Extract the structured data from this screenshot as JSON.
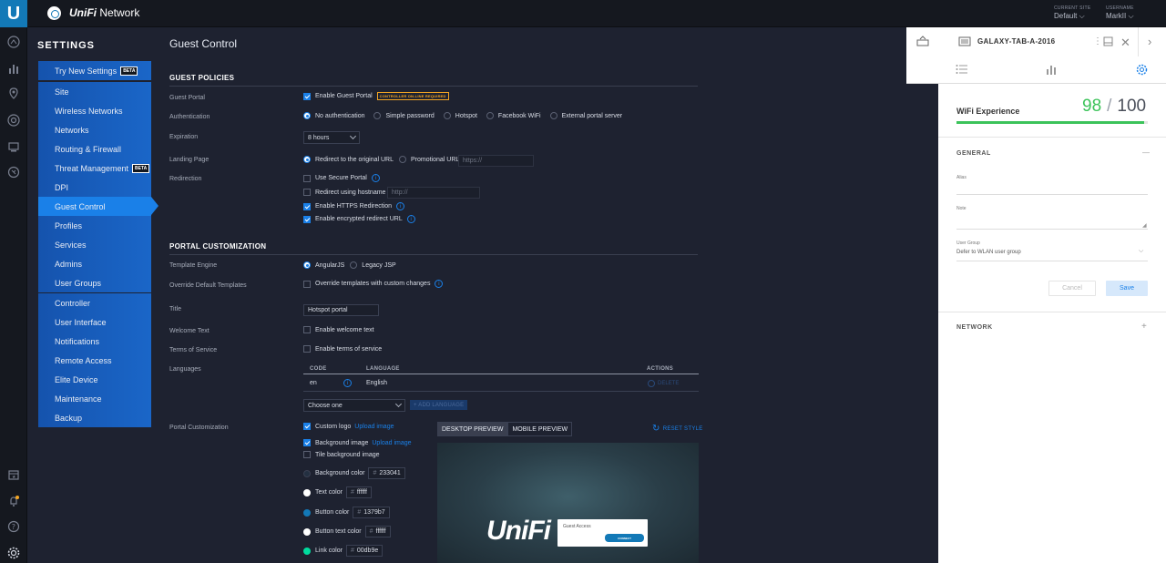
{
  "app": {
    "brand_part1": "UniFi",
    "brand_part2": " Network",
    "logo_letter": "U"
  },
  "header": {
    "current_site_label": "CURRENT SITE",
    "current_site_value": "Default",
    "username_label": "USERNAME",
    "username_value": "MarkII"
  },
  "settings": {
    "title": "SETTINGS",
    "menu_top": [
      {
        "label": "Try New Settings",
        "badge": "BETA"
      }
    ],
    "menu_main": [
      {
        "label": "Site"
      },
      {
        "label": "Wireless Networks"
      },
      {
        "label": "Networks"
      },
      {
        "label": "Routing & Firewall"
      },
      {
        "label": "Threat Management",
        "badge": "BETA"
      },
      {
        "label": "DPI"
      },
      {
        "label": "Guest Control",
        "active": true
      },
      {
        "label": "Profiles"
      },
      {
        "label": "Services"
      },
      {
        "label": "Admins"
      },
      {
        "label": "User Groups"
      }
    ],
    "menu_bottom": [
      {
        "label": "Controller"
      },
      {
        "label": "User Interface"
      },
      {
        "label": "Notifications"
      },
      {
        "label": "Remote Access"
      },
      {
        "label": "Elite Device"
      },
      {
        "label": "Maintenance"
      },
      {
        "label": "Backup"
      }
    ]
  },
  "page": {
    "title": "Guest Control",
    "guest_policies": {
      "heading": "GUEST POLICIES",
      "guest_portal_label": "Guest Portal",
      "enable_guest_portal": "Enable Guest Portal",
      "controller_badge": "CONTROLLER ON-LINE REQUIRED",
      "authentication_label": "Authentication",
      "auth_options": [
        "No authentication",
        "Simple password",
        "Hotspot",
        "Facebook WiFi",
        "External portal server"
      ],
      "expiration_label": "Expiration",
      "expiration_value": "8 hours",
      "landing_page_label": "Landing Page",
      "landing_redirect": "Redirect to the original URL",
      "landing_promo": "Promotional URL",
      "landing_promo_placeholder": "https://",
      "redirection_label": "Redirection",
      "use_secure_portal": "Use Secure Portal",
      "redirect_hostname": "Redirect using hostname",
      "redirect_hostname_placeholder": "http://",
      "enable_https": "Enable HTTPS Redirection",
      "enable_encrypted": "Enable encrypted redirect URL"
    },
    "portal_customization": {
      "heading": "PORTAL CUSTOMIZATION",
      "template_engine_label": "Template Engine",
      "template_angular": "AngularJS",
      "template_legacy": "Legacy JSP",
      "override_label": "Override Default Templates",
      "override_text": "Override templates with custom changes",
      "title_label": "Title",
      "title_value": "Hotspot portal",
      "welcome_label": "Welcome Text",
      "welcome_text": "Enable welcome text",
      "tos_label": "Terms of Service",
      "tos_text": "Enable terms of service",
      "languages_label": "Languages",
      "lang_cols": {
        "code": "CODE",
        "language": "LANGUAGE",
        "actions": "ACTIONS"
      },
      "lang_rows": [
        {
          "code": "en",
          "language": "English",
          "action": "DELETE"
        }
      ],
      "lang_select": "Choose one",
      "add_language": "+ ADD LANGUAGE",
      "portal_custom_label": "Portal Customization",
      "custom_logo": "Custom logo",
      "upload_image": "Upload image",
      "background_image": "Background image",
      "tile_background": "Tile background image",
      "colors": [
        {
          "label": "Background color",
          "hex": "233041",
          "swatch": "#233041"
        },
        {
          "label": "Text color",
          "hex": "ffffff",
          "swatch": "#ffffff"
        },
        {
          "label": "Button color",
          "hex": "1379b7",
          "swatch": "#1379b7"
        },
        {
          "label": "Button text color",
          "hex": "ffffff",
          "swatch": "#ffffff"
        },
        {
          "label": "Link color",
          "hex": "00db9e",
          "swatch": "#00db9e"
        }
      ],
      "hash": "#",
      "desktop_preview": "DESKTOP PREVIEW",
      "mobile_preview": "MOBILE PREVIEW",
      "reset_style": "RESET STYLE",
      "preview_logo": "UniFi",
      "preview_card_title": "Guest Access",
      "preview_card_button": "CONNECT"
    }
  },
  "device_panel": {
    "title": "GALAXY-TAB-A-2016",
    "wifi_experience_label": "WiFi Experience",
    "score": "98",
    "score_sep": "/",
    "score_max": "100",
    "score_fraction": 0.98,
    "general_heading": "GENERAL",
    "alias_label": "Alias",
    "note_label": "Note",
    "user_group_label": "User Group",
    "user_group_value": "Defer to WLAN user group",
    "cancel_label": "Cancel",
    "save_label": "Save",
    "network_heading": "NETWORK",
    "collapse_symbol": "—",
    "expand_symbol": "+"
  },
  "colors": {
    "accent": "#1a80e8",
    "success": "#3cc35a",
    "warning": "#f5a623",
    "brand": "#1379b7"
  }
}
